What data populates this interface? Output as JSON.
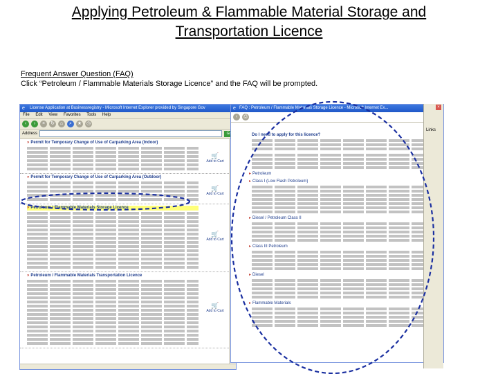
{
  "slide": {
    "title_line1": "Applying Petroleum & Flammable Material Storage and",
    "title_line2": "Transportation Licence",
    "faq_heading": "Frequent Answer Question (FAQ)",
    "faq_instruction": "Click “Petroleum / Flammable Materials Storage Licence” and the FAQ will be prompted."
  },
  "browser": {
    "title": "License Application at Businessregistry - Microsoft Internet Explorer provided by Singapore Gov",
    "menu": [
      "File",
      "Edit",
      "View",
      "Favorites",
      "Tools",
      "Help"
    ],
    "address_label": "Address",
    "go_label": "Go",
    "permits": [
      {
        "title": "Permit for Temporary Change of Use of Carparking Area (Indoor)",
        "apply": "Add to Cart"
      },
      {
        "title": "Permit for Temporary Change of Use of Carparking Area (Outdoor)",
        "apply": "Add to Cart"
      },
      {
        "title": "Petroleum / Flammable Materials Storage Licence",
        "apply": "Add to Cart"
      },
      {
        "title": "Petroleum / Flammable Materials Transportation Licence",
        "apply": "Add to Cart"
      }
    ]
  },
  "popup": {
    "title": "FAQ : Petroleum / Flammable Materials Storage Licence - Microsoft Internet Ex...",
    "question": "Do I need to apply for this licence?",
    "items": [
      "Petroleum",
      "Class I (Low Flash Petroleum)",
      "Diesel / Petroleum Class II",
      "Class III Petroleum",
      "Diesel",
      "Flammable Materials"
    ]
  },
  "side": {
    "link": "Links"
  },
  "colors": {
    "annotation": "#1a2fa0",
    "title_bar": "#1f57c8"
  }
}
